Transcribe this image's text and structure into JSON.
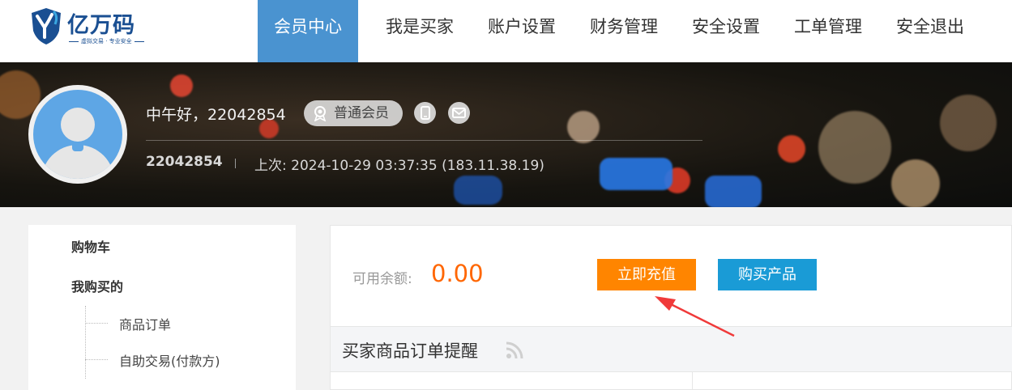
{
  "brand": {
    "name": "亿万码",
    "slogan": "虚拟交易 · 专业安全"
  },
  "nav": {
    "items": [
      "会员中心",
      "我是买家",
      "账户设置",
      "财务管理",
      "安全设置",
      "工单管理",
      "安全退出"
    ],
    "active": "会员中心"
  },
  "profile": {
    "greeting": "中午好，22042854",
    "level_badge": "普通会员",
    "user_id": "22042854",
    "last_login": "上次: 2024-10-29 03:37:35 (183.11.38.19)"
  },
  "sidebar": {
    "cart": "购物车",
    "my_purchases": "我购买的",
    "sub_items": [
      "商品订单",
      "自助交易(付款方)"
    ]
  },
  "account": {
    "balance_label": "可用余额:",
    "balance_value": "0.00",
    "recharge_button": "立即充值",
    "buy_button": "购买产品"
  },
  "orders": {
    "title": "买家商品订单提醒"
  },
  "colors": {
    "nav_active": "#4a93d0",
    "recharge": "#ff8500",
    "buy": "#1a9bd6",
    "balance": "#ff6600",
    "annotation_arrow": "#f03a3a"
  },
  "icons": {
    "logo": "shield-y-logo-icon",
    "badge": "medal-icon",
    "phone": "phone-icon",
    "mail": "mail-icon",
    "rss": "rss-icon"
  }
}
